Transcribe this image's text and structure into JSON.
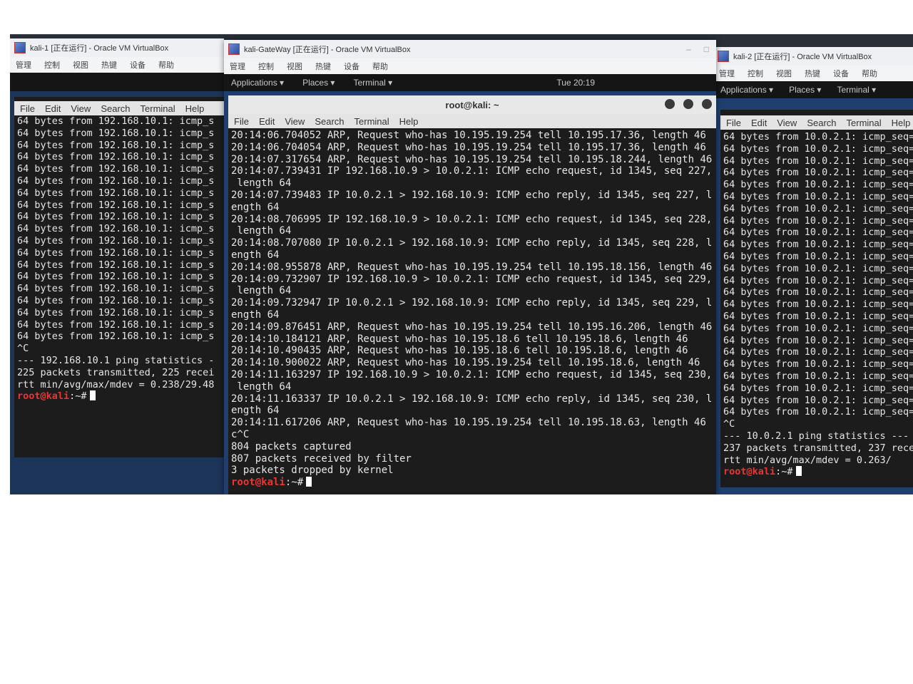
{
  "vm_menu": [
    "管理",
    "控制",
    "视图",
    "热键",
    "设备",
    "帮助"
  ],
  "term_menu": [
    "File",
    "Edit",
    "View",
    "Search",
    "Terminal",
    "Help"
  ],
  "vm1": {
    "title": "kali-1 [正在运行] - Oracle VM VirtualBox",
    "lines": [
      "64 bytes from 192.168.10.1: icmp_s",
      "64 bytes from 192.168.10.1: icmp_s",
      "64 bytes from 192.168.10.1: icmp_s",
      "64 bytes from 192.168.10.1: icmp_s",
      "64 bytes from 192.168.10.1: icmp_s",
      "64 bytes from 192.168.10.1: icmp_s",
      "64 bytes from 192.168.10.1: icmp_s",
      "64 bytes from 192.168.10.1: icmp_s",
      "64 bytes from 192.168.10.1: icmp_s",
      "64 bytes from 192.168.10.1: icmp_s",
      "64 bytes from 192.168.10.1: icmp_s",
      "64 bytes from 192.168.10.1: icmp_s",
      "64 bytes from 192.168.10.1: icmp_s",
      "64 bytes from 192.168.10.1: icmp_s",
      "64 bytes from 192.168.10.1: icmp_s",
      "64 bytes from 192.168.10.1: icmp_s",
      "64 bytes from 192.168.10.1: icmp_s",
      "64 bytes from 192.168.10.1: icmp_s",
      "64 bytes from 192.168.10.1: icmp_s",
      "^C",
      "--- 192.168.10.1 ping statistics -",
      "225 packets transmitted, 225 recei",
      "rtt min/avg/max/mdev = 0.238/29.48"
    ],
    "prompt": "root@kali",
    "prompt_suffix": ":~#"
  },
  "vm2": {
    "title": "kali-GateWay [正在运行] - Oracle VM VirtualBox",
    "gnome": {
      "applications": "Applications ▾",
      "places": "Places ▾",
      "terminal": "Terminal ▾",
      "clock": "Tue 20:19"
    },
    "term_title": "root@kali: ~",
    "lines": [
      "20:14:06.704052 ARP, Request who-has 10.195.19.254 tell 10.195.17.36, length 46",
      "20:14:06.704054 ARP, Request who-has 10.195.19.254 tell 10.195.17.36, length 46",
      "20:14:07.317654 ARP, Request who-has 10.195.19.254 tell 10.195.18.244, length 46",
      "20:14:07.739431 IP 192.168.10.9 > 10.0.2.1: ICMP echo request, id 1345, seq 227,",
      " length 64",
      "20:14:07.739483 IP 10.0.2.1 > 192.168.10.9: ICMP echo reply, id 1345, seq 227, l",
      "ength 64",
      "20:14:08.706995 IP 192.168.10.9 > 10.0.2.1: ICMP echo request, id 1345, seq 228,",
      " length 64",
      "20:14:08.707080 IP 10.0.2.1 > 192.168.10.9: ICMP echo reply, id 1345, seq 228, l",
      "ength 64",
      "20:14:08.955878 ARP, Request who-has 10.195.19.254 tell 10.195.18.156, length 46",
      "20:14:09.732907 IP 192.168.10.9 > 10.0.2.1: ICMP echo request, id 1345, seq 229,",
      " length 64",
      "20:14:09.732947 IP 10.0.2.1 > 192.168.10.9: ICMP echo reply, id 1345, seq 229, l",
      "ength 64",
      "20:14:09.876451 ARP, Request who-has 10.195.19.254 tell 10.195.16.206, length 46",
      "20:14:10.184121 ARP, Request who-has 10.195.18.6 tell 10.195.18.6, length 46",
      "20:14:10.490435 ARP, Request who-has 10.195.18.6 tell 10.195.18.6, length 46",
      "20:14:10.900022 ARP, Request who-has 10.195.19.254 tell 10.195.18.6, length 46",
      "20:14:11.163297 IP 192.168.10.9 > 10.0.2.1: ICMP echo request, id 1345, seq 230,",
      " length 64",
      "20:14:11.163337 IP 10.0.2.1 > 192.168.10.9: ICMP echo reply, id 1345, seq 230, l",
      "ength 64",
      "20:14:11.617206 ARP, Request who-has 10.195.19.254 tell 10.195.18.63, length 46",
      "c^C",
      "804 packets captured",
      "807 packets received by filter",
      "3 packets dropped by kernel"
    ],
    "prompt": "root@kali",
    "prompt_suffix": ":~#"
  },
  "vm3": {
    "title": "kali-2 [正在运行] - Oracle VM VirtualBox",
    "gnome": {
      "applications": "Applications ▾",
      "places": "Places ▾",
      "terminal": "Terminal ▾"
    },
    "lines": [
      "64 bytes from 10.0.2.1: icmp_seq=",
      "64 bytes from 10.0.2.1: icmp_seq=",
      "64 bytes from 10.0.2.1: icmp_seq=",
      "64 bytes from 10.0.2.1: icmp_seq=",
      "64 bytes from 10.0.2.1: icmp_seq=",
      "64 bytes from 10.0.2.1: icmp_seq=",
      "64 bytes from 10.0.2.1: icmp_seq=",
      "64 bytes from 10.0.2.1: icmp_seq=",
      "64 bytes from 10.0.2.1: icmp_seq=",
      "64 bytes from 10.0.2.1: icmp_seq=",
      "64 bytes from 10.0.2.1: icmp_seq=",
      "64 bytes from 10.0.2.1: icmp_seq=",
      "64 bytes from 10.0.2.1: icmp_seq=",
      "64 bytes from 10.0.2.1: icmp_seq=",
      "64 bytes from 10.0.2.1: icmp_seq=",
      "64 bytes from 10.0.2.1: icmp_seq=",
      "64 bytes from 10.0.2.1: icmp_seq=",
      "64 bytes from 10.0.2.1: icmp_seq=",
      "64 bytes from 10.0.2.1: icmp_seq=",
      "64 bytes from 10.0.2.1: icmp_seq=",
      "64 bytes from 10.0.2.1: icmp_seq=",
      "64 bytes from 10.0.2.1: icmp_seq=",
      "64 bytes from 10.0.2.1: icmp_seq=",
      "64 bytes from 10.0.2.1: icmp_seq=",
      "^C",
      "--- 10.0.2.1 ping statistics ---",
      "237 packets transmitted, 237 rece",
      "rtt min/avg/max/mdev = 0.263/"
    ],
    "prompt": "root@kali",
    "prompt_suffix": ":~#"
  }
}
